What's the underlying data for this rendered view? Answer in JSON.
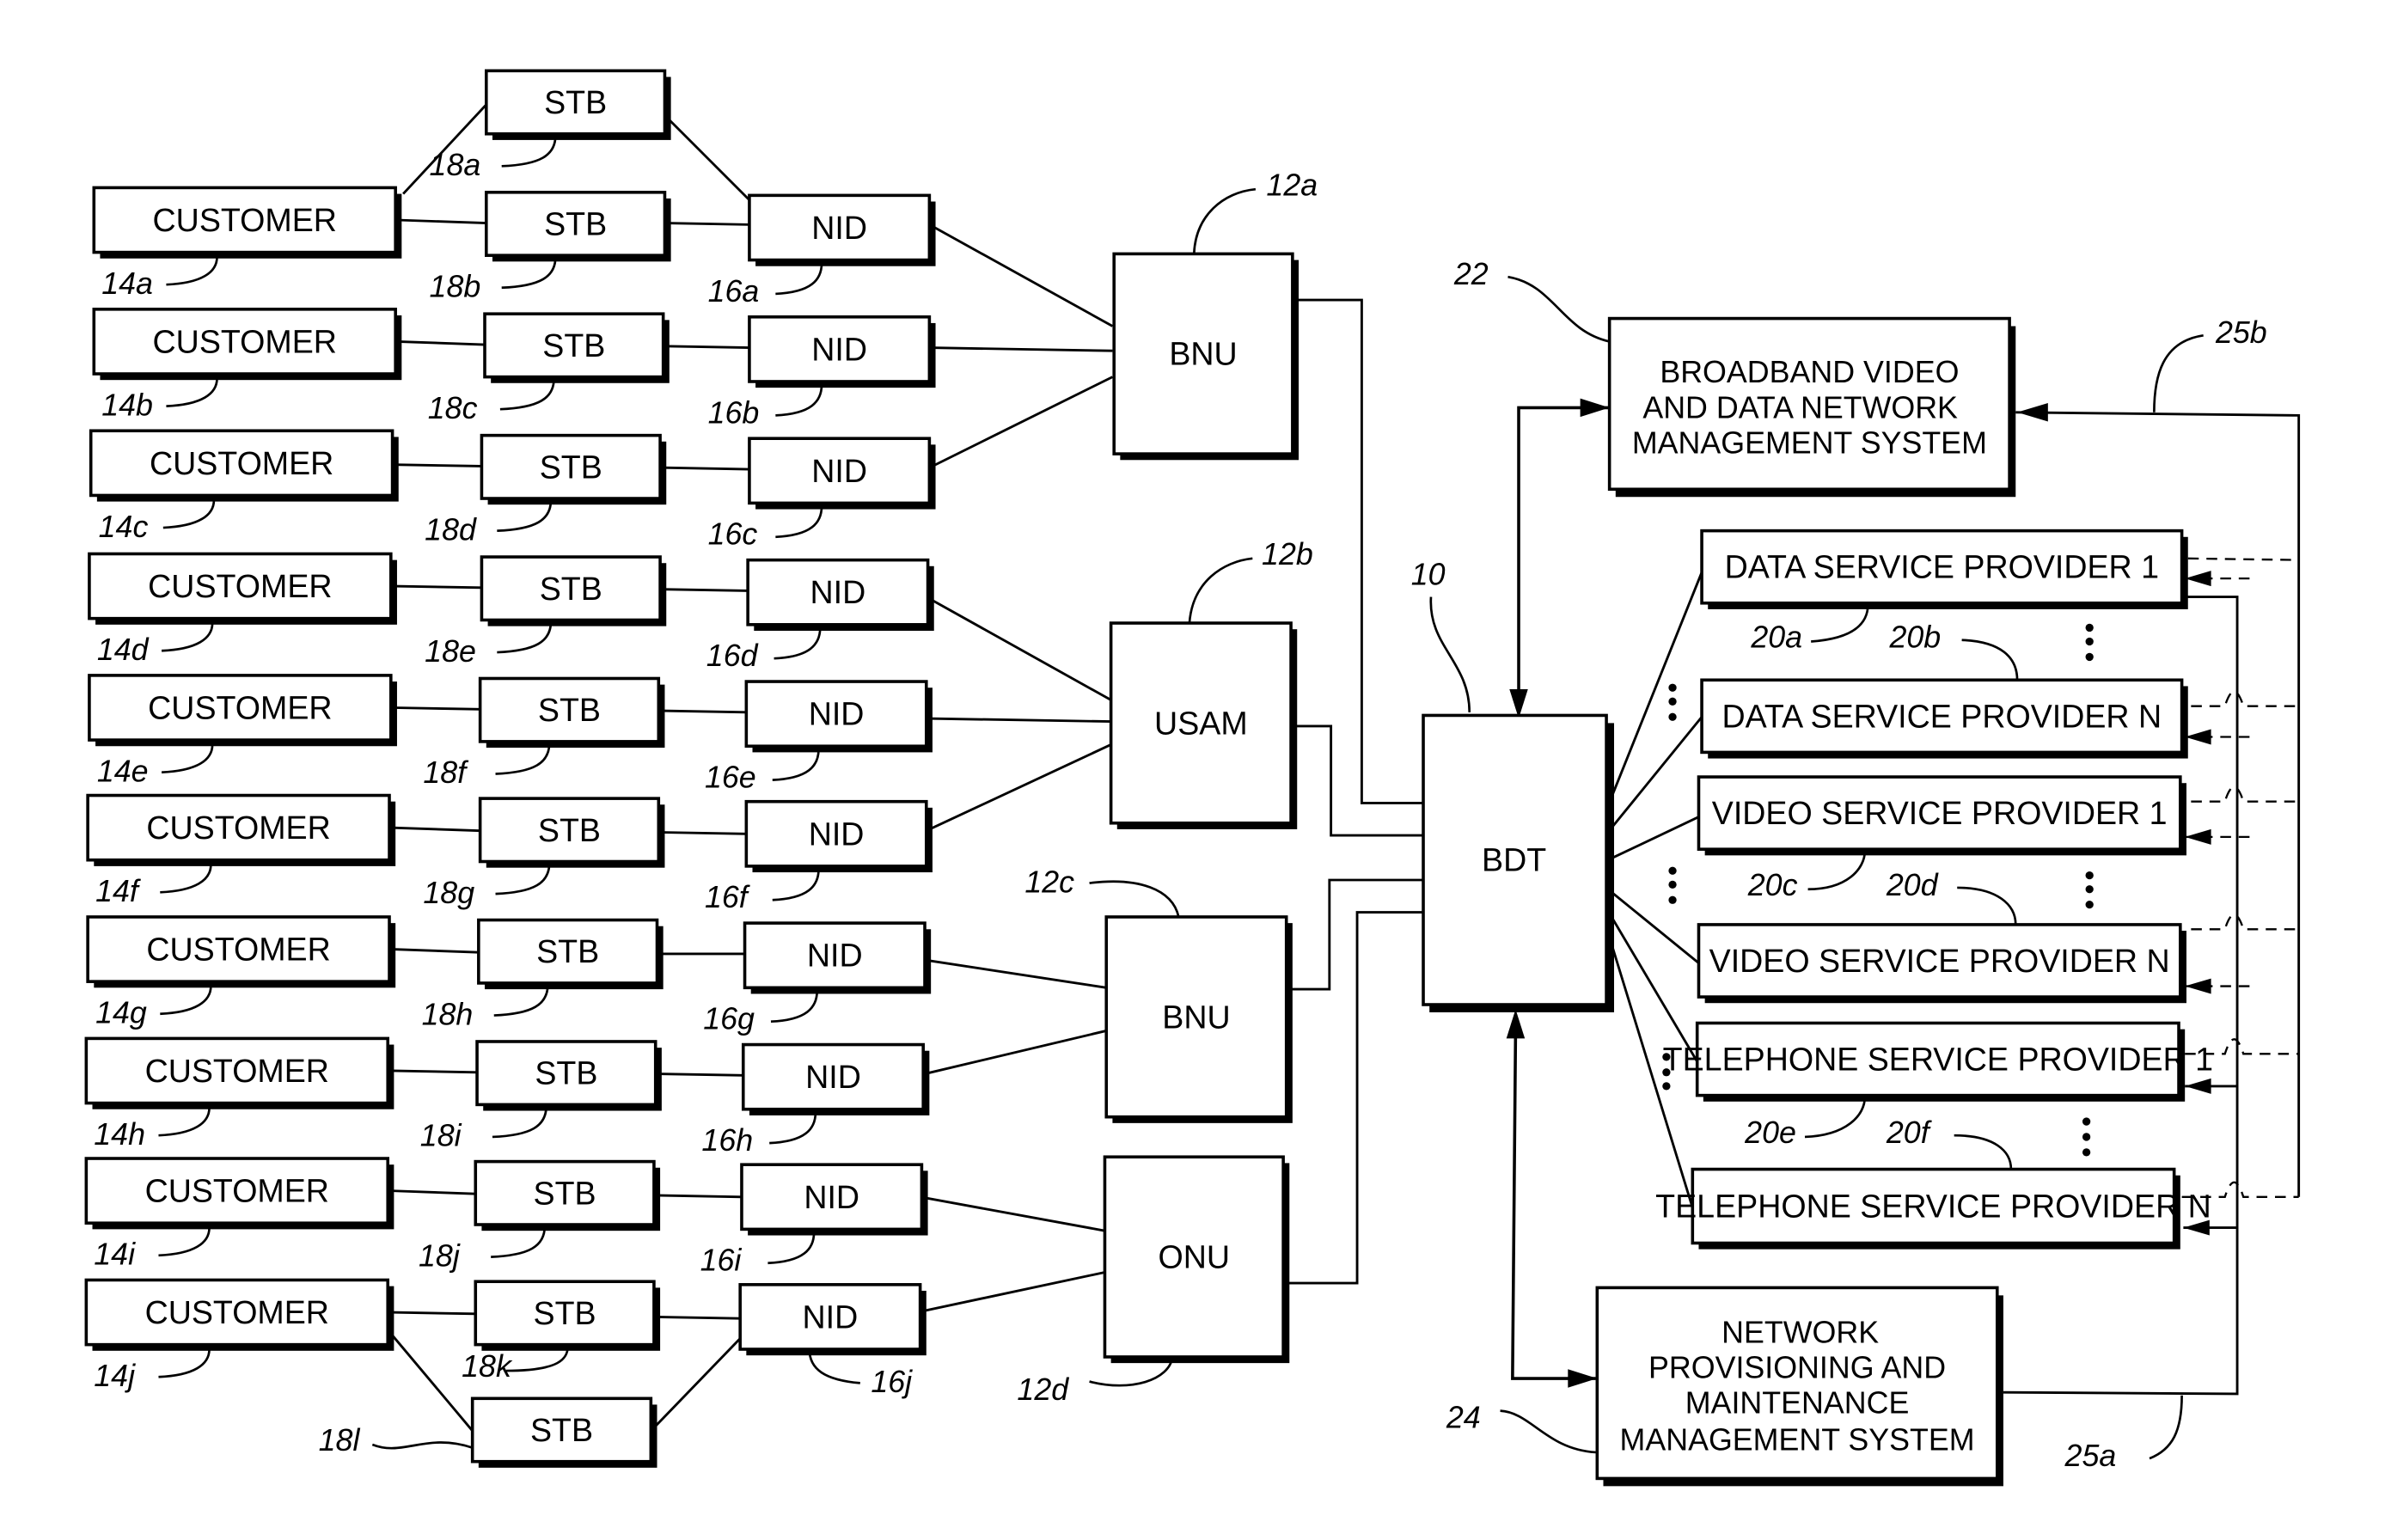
{
  "figure": {
    "customers": [
      {
        "label": "CUSTOMER",
        "ref": "14a"
      },
      {
        "label": "CUSTOMER",
        "ref": "14b"
      },
      {
        "label": "CUSTOMER",
        "ref": "14c"
      },
      {
        "label": "CUSTOMER",
        "ref": "14d"
      },
      {
        "label": "CUSTOMER",
        "ref": "14e"
      },
      {
        "label": "CUSTOMER",
        "ref": "14f"
      },
      {
        "label": "CUSTOMER",
        "ref": "14g"
      },
      {
        "label": "CUSTOMER",
        "ref": "14h"
      },
      {
        "label": "CUSTOMER",
        "ref": "14i"
      },
      {
        "label": "CUSTOMER",
        "ref": "14j"
      }
    ],
    "stbs": [
      {
        "label": "STB",
        "ref": "18a"
      },
      {
        "label": "STB",
        "ref": "18b"
      },
      {
        "label": "STB",
        "ref": "18c"
      },
      {
        "label": "STB",
        "ref": "18d"
      },
      {
        "label": "STB",
        "ref": "18e"
      },
      {
        "label": "STB",
        "ref": "18f"
      },
      {
        "label": "STB",
        "ref": "18g"
      },
      {
        "label": "STB",
        "ref": "18h"
      },
      {
        "label": "STB",
        "ref": "18i"
      },
      {
        "label": "STB",
        "ref": "18j"
      },
      {
        "label": "STB",
        "ref": "18k"
      },
      {
        "label": "STB",
        "ref": "18l"
      }
    ],
    "nids": [
      {
        "label": "NID",
        "ref": "16a"
      },
      {
        "label": "NID",
        "ref": "16b"
      },
      {
        "label": "NID",
        "ref": "16c"
      },
      {
        "label": "NID",
        "ref": "16d"
      },
      {
        "label": "NID",
        "ref": "16e"
      },
      {
        "label": "NID",
        "ref": "16f"
      },
      {
        "label": "NID",
        "ref": "16g"
      },
      {
        "label": "NID",
        "ref": "16h"
      },
      {
        "label": "NID",
        "ref": "16i"
      },
      {
        "label": "NID",
        "ref": "16j"
      }
    ],
    "access_units": [
      {
        "label": "BNU",
        "ref": "12a"
      },
      {
        "label": "USAM",
        "ref": "12b"
      },
      {
        "label": "BNU",
        "ref": "12c"
      },
      {
        "label": "ONU",
        "ref": "12d"
      }
    ],
    "bdt": {
      "label": "BDT",
      "ref": "10"
    },
    "network_mgmt": {
      "lines": [
        "BROADBAND VIDEO",
        "AND DATA NETWORK",
        "MANAGEMENT SYSTEM"
      ],
      "ref": "22"
    },
    "providers": [
      {
        "label": "DATA SERVICE PROVIDER 1",
        "ref": "20a"
      },
      {
        "label": "DATA SERVICE PROVIDER N",
        "ref": "20b"
      },
      {
        "label": "VIDEO  SERVICE PROVIDER 1",
        "ref": "20c"
      },
      {
        "label": "VIDEO SERVICE PROVIDER N",
        "ref": "20d"
      },
      {
        "label": "TELEPHONE SERVICE PROVIDER 1",
        "ref": "20e"
      },
      {
        "label": "TELEPHONE SERVICE PROVIDER N",
        "ref": "20f"
      }
    ],
    "provisioning": {
      "lines": [
        "NETWORK",
        "PROVISIONING AND",
        "MAINTENANCE",
        "MANAGEMENT SYSTEM"
      ],
      "ref": "24"
    },
    "bus_refs": {
      "upper": "25b",
      "lower": "25a"
    }
  }
}
